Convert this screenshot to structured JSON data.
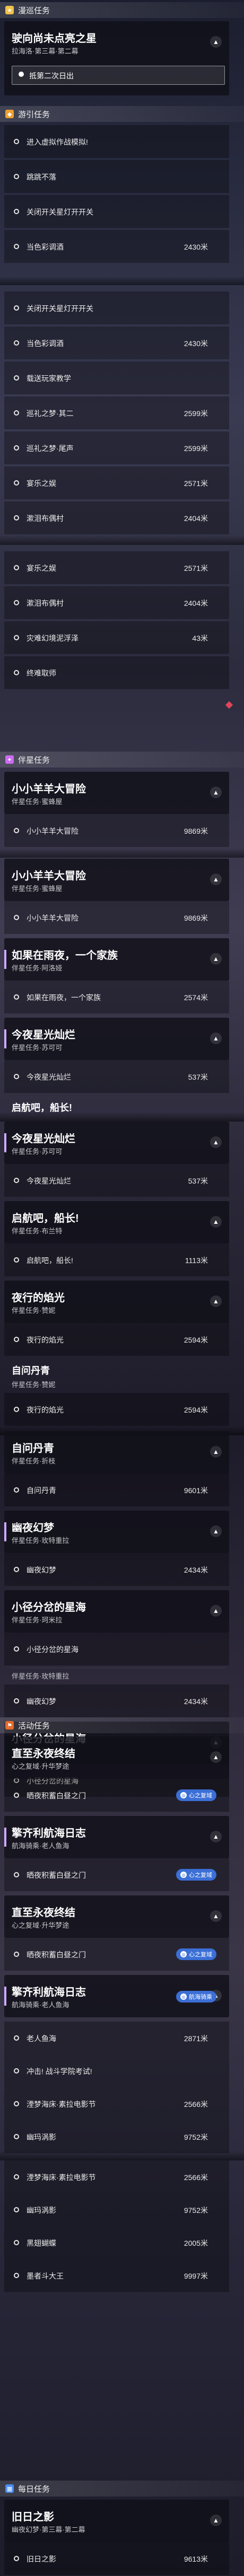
{
  "sections": {
    "main": {
      "title": "漫巡任务",
      "icon": "star-icon",
      "color": "#f0c24a"
    },
    "trail": {
      "title": "游引任务",
      "icon": "compass-icon",
      "color": "#f0a030"
    },
    "companion": {
      "title": "伴星任务",
      "icon": "heart-star-icon",
      "color": "#c96df0"
    },
    "event": {
      "title": "活动任务",
      "icon": "flag-icon",
      "color": "#e56b2a"
    },
    "daily": {
      "title": "每日任务",
      "icon": "calendar-icon",
      "color": "#4a8cf0"
    }
  },
  "main_card": {
    "title": "驶向尚未点亮之星",
    "subtitle": "拉海洛·第三幕·第二幕",
    "selected": "抵第二次日出"
  },
  "trail_items_a": [
    {
      "label": "进入虚拟作战模拟!",
      "value": ""
    },
    {
      "label": "跳跳不落",
      "value": ""
    },
    {
      "label": "关闭开关星灯开开关",
      "value": ""
    },
    {
      "label": "当色彩调酒",
      "value": "2430米"
    }
  ],
  "trail_items_b": [
    {
      "label": "关闭开关星灯开开关",
      "value": ""
    },
    {
      "label": "当色彩调酒",
      "value": "2430米"
    },
    {
      "label": "载送玩家教学",
      "value": ""
    },
    {
      "label": "巡礼之梦·其二",
      "value": "2599米"
    },
    {
      "label": "巡礼之梦·尾声",
      "value": "2599米"
    },
    {
      "label": "宴乐之娱",
      "value": "2571米"
    },
    {
      "label": "漱泪布偶村",
      "value": "2404米"
    }
  ],
  "trail_items_c": [
    {
      "label": "宴乐之娱",
      "value": "2571米"
    },
    {
      "label": "漱泪布偶村",
      "value": "2404米"
    },
    {
      "label": "灾难幻境泥浮泽",
      "value": "43米"
    },
    {
      "label": "终难取师",
      "value": ""
    }
  ],
  "companion_cards": {
    "c1": {
      "title": "小小羊羊大冒险",
      "subtitle": "伴星任务·蜜蜂屋",
      "row": "小小羊羊大冒险",
      "value": "9869米"
    },
    "c2": {
      "title": "小小羊羊大冒险",
      "subtitle": "伴星任务·蜜蜂屋",
      "row": "小小羊羊大冒险",
      "value": "9869米"
    },
    "c3": {
      "title": "如果在雨夜，一个家族",
      "subtitle": "伴星任务·阿洛娅",
      "row": "如果在雨夜，一个家族",
      "value": "2574米"
    },
    "c4": {
      "title": "今夜星光灿烂",
      "subtitle": "伴星任务·苏可可",
      "row": "今夜星光灿烂",
      "value": "537米"
    },
    "c5_peek": "启航吧，船长!",
    "c5": {
      "title": "今夜星光灿烂",
      "subtitle": "伴星任务·苏可可",
      "row": "今夜星光灿烂",
      "value": "537米"
    },
    "c6": {
      "title": "启航吧，船长!",
      "subtitle": "伴星任务·布兰特",
      "row": "启航吧，船长!",
      "value": "1113米"
    },
    "c7": {
      "title": "夜行的焰光",
      "subtitle": "伴星任务·赞妮",
      "row": "夜行的焰光",
      "value": "2594米"
    },
    "c8_peek": "自问丹青",
    "c8_sub": "伴星任务·赞妮",
    "c8": {
      "row": "夜行的焰光",
      "value": "2594米"
    },
    "c9": {
      "title": "自问丹青",
      "subtitle": "伴星任务·折枝",
      "row": "自问丹青",
      "value": "9601米"
    },
    "c10": {
      "title": "幽夜幻梦",
      "subtitle": "伴星任务·玫特重拉",
      "row": "幽夜幻梦",
      "value": "2434米"
    },
    "c11": {
      "title": "小径分岔的星海",
      "subtitle": "伴星任务·珂米拉",
      "row": "小径分岔的星海",
      "value": ""
    },
    "c11_sub2": "伴星任务·玫特重拉",
    "c11_row2": {
      "label": "幽夜幻梦",
      "value": "2434米"
    },
    "c12": {
      "title": "小径分岔的星海",
      "subtitle": "伴星任务·珂米拉",
      "row": "小径分岔的星海",
      "value": ""
    }
  },
  "event_cards": {
    "e1": {
      "title": "直至永夜终结",
      "subtitle": "心之复域·升华梦途",
      "row": "晒夜积蓄白昼之门",
      "badge": "心之复域"
    },
    "e2": {
      "title": "擎齐利航海日志",
      "subtitle": "航海骑乘·老人鱼海",
      "row": "晒夜积蓄白昼之门",
      "badge": "心之复域"
    },
    "e3": {
      "title": "直至永夜终结",
      "subtitle": "心之复域·升华梦途",
      "row": "晒夜积蓄白昼之门",
      "badge": "心之复域"
    },
    "e4": {
      "title": "擎齐利航海日志",
      "subtitle": "航海骑乘·老人鱼海",
      "badge": "航海骑乘"
    },
    "e_rows": [
      {
        "label": "老人鱼海",
        "value": "2871米"
      },
      {
        "label": "冲击! 战斗学院考试!",
        "value": ""
      },
      {
        "label": "湮梦海床·素拉电影节",
        "value": "2566米"
      },
      {
        "label": "幽玛涡影",
        "value": "9752米"
      },
      {
        "label": "湮梦海床·素拉电影节",
        "value": "2566米"
      },
      {
        "label": "幽玛涡影",
        "value": "9752米"
      },
      {
        "label": "黑翅蝴蝶",
        "value": "2005米"
      },
      {
        "label": "墨者斗大王",
        "value": "9997米"
      }
    ]
  },
  "daily_card": {
    "title": "旧日之影",
    "subtitle": "幽夜幻梦·第三幕·第二幕",
    "row": "旧日之影",
    "value": "9613米"
  }
}
